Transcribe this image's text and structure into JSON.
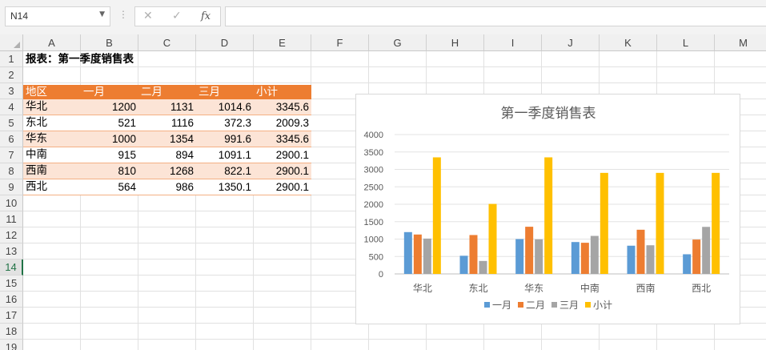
{
  "formula_bar": {
    "name_box": "N14",
    "dots": "⋮",
    "cancel_glyph": "✕",
    "enter_glyph": "✓",
    "fx_label": "fx",
    "formula": ""
  },
  "columns": [
    "A",
    "B",
    "C",
    "D",
    "E",
    "F",
    "G",
    "H",
    "I",
    "J",
    "K",
    "L",
    "M"
  ],
  "rows": [
    "1",
    "2",
    "3",
    "4",
    "5",
    "6",
    "7",
    "8",
    "9",
    "10",
    "11",
    "12",
    "13",
    "14",
    "15",
    "16",
    "17",
    "18",
    "19"
  ],
  "selected_row": "14",
  "sheet": {
    "title": "报表：第一季度销售表",
    "headers": [
      "地区",
      "一月",
      "二月",
      "三月",
      "小计"
    ],
    "data": [
      [
        "华北",
        "1200",
        "1131",
        "1014.6",
        "3345.6"
      ],
      [
        "东北",
        "521",
        "1116",
        "372.3",
        "2009.3"
      ],
      [
        "华东",
        "1000",
        "1354",
        "991.6",
        "3345.6"
      ],
      [
        "中南",
        "915",
        "894",
        "1091.1",
        "2900.1"
      ],
      [
        "西南",
        "810",
        "1268",
        "822.1",
        "2900.1"
      ],
      [
        "西北",
        "564",
        "986",
        "1350.1",
        "2900.1"
      ]
    ]
  },
  "colors": {
    "header_fill": "#ED7D31",
    "band_fill": "#FCE4D6",
    "selected": "#217346"
  },
  "chart_data": {
    "type": "bar",
    "title": "第一季度销售表",
    "categories": [
      "华北",
      "东北",
      "华东",
      "中南",
      "西南",
      "西北"
    ],
    "series": [
      {
        "name": "一月",
        "color": "#5B9BD5",
        "values": [
          1200,
          521,
          1000,
          915,
          810,
          564
        ]
      },
      {
        "name": "二月",
        "color": "#ED7D31",
        "values": [
          1131,
          1116,
          1354,
          894,
          1268,
          986
        ]
      },
      {
        "name": "三月",
        "color": "#A5A5A5",
        "values": [
          1014.6,
          372.3,
          991.6,
          1091.1,
          822.1,
          1350.1
        ]
      },
      {
        "name": "小计",
        "color": "#FFC000",
        "values": [
          3345.6,
          2009.3,
          3345.6,
          2900.1,
          2900.1,
          2900.1
        ]
      }
    ],
    "yticks": [
      "0",
      "500",
      "1000",
      "1500",
      "2000",
      "2500",
      "3000",
      "3500",
      "4000"
    ],
    "ylim": [
      0,
      4000
    ],
    "grid": true,
    "legend": "bottom"
  }
}
